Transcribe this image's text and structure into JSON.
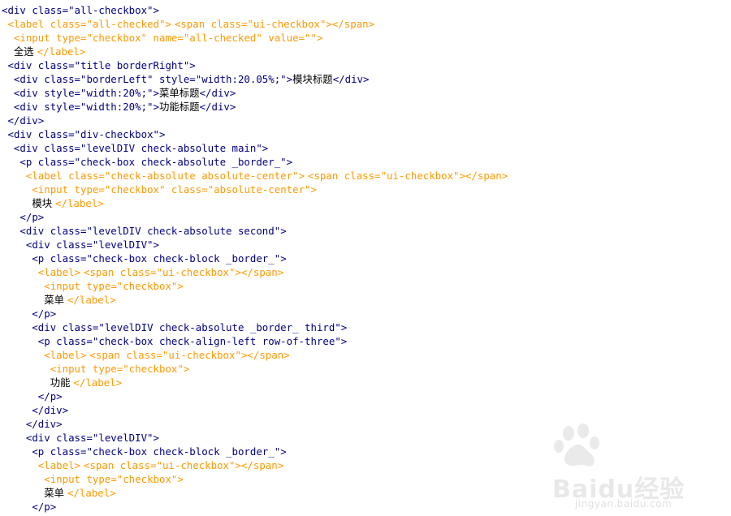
{
  "code_lines": [
    {
      "indent": 0,
      "kind": "",
      "tokens": [
        [
          "p",
          "<"
        ],
        [
          "t",
          "div"
        ],
        [
          "a",
          " class="
        ],
        [
          "s",
          "\"all-checkbox\""
        ],
        [
          "p",
          ">"
        ]
      ]
    },
    {
      "indent": 1,
      "kind": "lbl",
      "tokens": [
        [
          "p",
          "<"
        ],
        [
          "t",
          "label"
        ],
        [
          "a",
          " class="
        ],
        [
          "s",
          "\"all-checked\""
        ],
        [
          "p",
          ">"
        ],
        [
          "x",
          " "
        ],
        [
          "p",
          "<"
        ],
        [
          "t",
          "span"
        ],
        [
          "a",
          " class="
        ],
        [
          "s",
          "\"ui-checkbox\""
        ],
        [
          "p",
          "></"
        ],
        [
          "t",
          "span"
        ],
        [
          "p",
          ">"
        ]
      ]
    },
    {
      "indent": 2,
      "kind": "lbl",
      "tokens": [
        [
          "p",
          "<"
        ],
        [
          "t",
          "input"
        ],
        [
          "a",
          " type="
        ],
        [
          "s",
          "\"checkbox\""
        ],
        [
          "a",
          " name="
        ],
        [
          "s",
          "\"all-checked\""
        ],
        [
          "a",
          " value="
        ],
        [
          "s",
          "\"\""
        ],
        [
          "p",
          ">"
        ]
      ]
    },
    {
      "indent": 2,
      "kind": "lbl",
      "tokens": [
        [
          "x",
          "全选 "
        ],
        [
          "p",
          "</"
        ],
        [
          "t",
          "label"
        ],
        [
          "p",
          ">"
        ]
      ]
    },
    {
      "indent": 1,
      "kind": "",
      "tokens": [
        [
          "p",
          "<"
        ],
        [
          "t",
          "div"
        ],
        [
          "a",
          " class="
        ],
        [
          "s",
          "\"title borderRight\""
        ],
        [
          "p",
          ">"
        ]
      ]
    },
    {
      "indent": 2,
      "kind": "",
      "tokens": [
        [
          "p",
          "<"
        ],
        [
          "t",
          "div"
        ],
        [
          "a",
          " class="
        ],
        [
          "s",
          "\"borderLeft\""
        ],
        [
          "a",
          " style="
        ],
        [
          "s",
          "\"width:20.05%;\""
        ],
        [
          "p",
          ">"
        ],
        [
          "x",
          "模块标题"
        ],
        [
          "p",
          "</"
        ],
        [
          "t",
          "div"
        ],
        [
          "p",
          ">"
        ]
      ]
    },
    {
      "indent": 2,
      "kind": "",
      "tokens": [
        [
          "p",
          "<"
        ],
        [
          "t",
          "div"
        ],
        [
          "a",
          " style="
        ],
        [
          "s",
          "\"width:20%;\""
        ],
        [
          "p",
          ">"
        ],
        [
          "x",
          "菜单标题"
        ],
        [
          "p",
          "</"
        ],
        [
          "t",
          "div"
        ],
        [
          "p",
          ">"
        ]
      ]
    },
    {
      "indent": 2,
      "kind": "",
      "tokens": [
        [
          "p",
          "<"
        ],
        [
          "t",
          "div"
        ],
        [
          "a",
          " style="
        ],
        [
          "s",
          "\"width:20%;\""
        ],
        [
          "p",
          ">"
        ],
        [
          "x",
          "功能标题"
        ],
        [
          "p",
          "</"
        ],
        [
          "t",
          "div"
        ],
        [
          "p",
          ">"
        ]
      ]
    },
    {
      "indent": 1,
      "kind": "",
      "tokens": [
        [
          "p",
          "</"
        ],
        [
          "t",
          "div"
        ],
        [
          "p",
          ">"
        ]
      ]
    },
    {
      "indent": 1,
      "kind": "",
      "tokens": [
        [
          "p",
          "<"
        ],
        [
          "t",
          "div"
        ],
        [
          "a",
          " class="
        ],
        [
          "s",
          "\"div-checkbox\""
        ],
        [
          "p",
          ">"
        ]
      ]
    },
    {
      "indent": 2,
      "kind": "",
      "tokens": [
        [
          "p",
          "<"
        ],
        [
          "t",
          "div"
        ],
        [
          "a",
          " class="
        ],
        [
          "s",
          "\"levelDIV check-absolute main\""
        ],
        [
          "p",
          ">"
        ]
      ]
    },
    {
      "indent": 3,
      "kind": "",
      "tokens": [
        [
          "p",
          "<"
        ],
        [
          "t",
          "p"
        ],
        [
          "a",
          " class="
        ],
        [
          "s",
          "\"check-box check-absolute _border_\""
        ],
        [
          "p",
          ">"
        ]
      ]
    },
    {
      "indent": 4,
      "kind": "lbl",
      "tokens": [
        [
          "p",
          "<"
        ],
        [
          "t",
          "label"
        ],
        [
          "a",
          " class="
        ],
        [
          "s",
          "\"check-absolute absolute-center\""
        ],
        [
          "p",
          ">"
        ],
        [
          "x",
          " "
        ],
        [
          "p",
          "<"
        ],
        [
          "t",
          "span"
        ],
        [
          "a",
          " class="
        ],
        [
          "s",
          "\"ui-checkbox\""
        ],
        [
          "p",
          "></"
        ],
        [
          "t",
          "span"
        ],
        [
          "p",
          ">"
        ]
      ]
    },
    {
      "indent": 5,
      "kind": "lbl",
      "tokens": [
        [
          "p",
          "<"
        ],
        [
          "t",
          "input"
        ],
        [
          "a",
          " type="
        ],
        [
          "s",
          "\"checkbox\""
        ],
        [
          "a",
          " class="
        ],
        [
          "s",
          "\"absolute-center\""
        ],
        [
          "p",
          ">"
        ]
      ]
    },
    {
      "indent": 5,
      "kind": "lbl",
      "tokens": [
        [
          "x",
          "模块 "
        ],
        [
          "p",
          "</"
        ],
        [
          "t",
          "label"
        ],
        [
          "p",
          ">"
        ]
      ]
    },
    {
      "indent": 3,
      "kind": "",
      "tokens": [
        [
          "p",
          "</"
        ],
        [
          "t",
          "p"
        ],
        [
          "p",
          ">"
        ]
      ]
    },
    {
      "indent": 3,
      "kind": "",
      "tokens": [
        [
          "p",
          "<"
        ],
        [
          "t",
          "div"
        ],
        [
          "a",
          " class="
        ],
        [
          "s",
          "\"levelDIV check-absolute second\""
        ],
        [
          "p",
          ">"
        ]
      ]
    },
    {
      "indent": 4,
      "kind": "",
      "tokens": [
        [
          "p",
          "<"
        ],
        [
          "t",
          "div"
        ],
        [
          "a",
          " class="
        ],
        [
          "s",
          "\"levelDIV\""
        ],
        [
          "p",
          ">"
        ]
      ]
    },
    {
      "indent": 5,
      "kind": "",
      "tokens": [
        [
          "p",
          "<"
        ],
        [
          "t",
          "p"
        ],
        [
          "a",
          " class="
        ],
        [
          "s",
          "\"check-box check-block _border_\""
        ],
        [
          "p",
          ">"
        ]
      ]
    },
    {
      "indent": 6,
      "kind": "lbl",
      "tokens": [
        [
          "p",
          "<"
        ],
        [
          "t",
          "label"
        ],
        [
          "p",
          ">"
        ],
        [
          "x",
          " "
        ],
        [
          "p",
          "<"
        ],
        [
          "t",
          "span"
        ],
        [
          "a",
          " class="
        ],
        [
          "s",
          "\"ui-checkbox\""
        ],
        [
          "p",
          "></"
        ],
        [
          "t",
          "span"
        ],
        [
          "p",
          ">"
        ]
      ]
    },
    {
      "indent": 7,
      "kind": "lbl",
      "tokens": [
        [
          "p",
          "<"
        ],
        [
          "t",
          "input"
        ],
        [
          "a",
          " type="
        ],
        [
          "s",
          "\"checkbox\""
        ],
        [
          "p",
          ">"
        ]
      ]
    },
    {
      "indent": 7,
      "kind": "lbl",
      "tokens": [
        [
          "x",
          "菜单 "
        ],
        [
          "p",
          "</"
        ],
        [
          "t",
          "label"
        ],
        [
          "p",
          ">"
        ]
      ]
    },
    {
      "indent": 5,
      "kind": "",
      "tokens": [
        [
          "p",
          "</"
        ],
        [
          "t",
          "p"
        ],
        [
          "p",
          ">"
        ]
      ]
    },
    {
      "indent": 5,
      "kind": "",
      "tokens": [
        [
          "p",
          "<"
        ],
        [
          "t",
          "div"
        ],
        [
          "a",
          " class="
        ],
        [
          "s",
          "\"levelDIV check-absolute _border_ third\""
        ],
        [
          "p",
          ">"
        ]
      ]
    },
    {
      "indent": 6,
      "kind": "",
      "tokens": [
        [
          "p",
          "<"
        ],
        [
          "t",
          "p"
        ],
        [
          "a",
          " class="
        ],
        [
          "s",
          "\"check-box check-align-left row-of-three\""
        ],
        [
          "p",
          ">"
        ]
      ]
    },
    {
      "indent": 7,
      "kind": "lbl",
      "tokens": [
        [
          "p",
          "<"
        ],
        [
          "t",
          "label"
        ],
        [
          "p",
          ">"
        ],
        [
          "x",
          " "
        ],
        [
          "p",
          "<"
        ],
        [
          "t",
          "span"
        ],
        [
          "a",
          " class="
        ],
        [
          "s",
          "\"ui-checkbox\""
        ],
        [
          "p",
          "></"
        ],
        [
          "t",
          "span"
        ],
        [
          "p",
          ">"
        ]
      ]
    },
    {
      "indent": 8,
      "kind": "lbl",
      "tokens": [
        [
          "p",
          "<"
        ],
        [
          "t",
          "input"
        ],
        [
          "a",
          " type="
        ],
        [
          "s",
          "\"checkbox\""
        ],
        [
          "p",
          ">"
        ]
      ]
    },
    {
      "indent": 8,
      "kind": "lbl",
      "tokens": [
        [
          "x",
          "功能 "
        ],
        [
          "p",
          "</"
        ],
        [
          "t",
          "label"
        ],
        [
          "p",
          ">"
        ]
      ]
    },
    {
      "indent": 6,
      "kind": "",
      "tokens": [
        [
          "p",
          "</"
        ],
        [
          "t",
          "p"
        ],
        [
          "p",
          ">"
        ]
      ]
    },
    {
      "indent": 5,
      "kind": "",
      "tokens": [
        [
          "p",
          "</"
        ],
        [
          "t",
          "div"
        ],
        [
          "p",
          ">"
        ]
      ]
    },
    {
      "indent": 4,
      "kind": "",
      "tokens": [
        [
          "p",
          "</"
        ],
        [
          "t",
          "div"
        ],
        [
          "p",
          ">"
        ]
      ]
    },
    {
      "indent": 4,
      "kind": "",
      "tokens": [
        [
          "p",
          "<"
        ],
        [
          "t",
          "div"
        ],
        [
          "a",
          " class="
        ],
        [
          "s",
          "\"levelDIV\""
        ],
        [
          "p",
          ">"
        ]
      ]
    },
    {
      "indent": 5,
      "kind": "",
      "tokens": [
        [
          "p",
          "<"
        ],
        [
          "t",
          "p"
        ],
        [
          "a",
          " class="
        ],
        [
          "s",
          "\"check-box check-block _border_\""
        ],
        [
          "p",
          ">"
        ]
      ]
    },
    {
      "indent": 6,
      "kind": "lbl",
      "tokens": [
        [
          "p",
          "<"
        ],
        [
          "t",
          "label"
        ],
        [
          "p",
          ">"
        ],
        [
          "x",
          " "
        ],
        [
          "p",
          "<"
        ],
        [
          "t",
          "span"
        ],
        [
          "a",
          " class="
        ],
        [
          "s",
          "\"ui-checkbox\""
        ],
        [
          "p",
          "></"
        ],
        [
          "t",
          "span"
        ],
        [
          "p",
          ">"
        ]
      ]
    },
    {
      "indent": 7,
      "kind": "lbl",
      "tokens": [
        [
          "p",
          "<"
        ],
        [
          "t",
          "input"
        ],
        [
          "a",
          " type="
        ],
        [
          "s",
          "\"checkbox\""
        ],
        [
          "p",
          ">"
        ]
      ]
    },
    {
      "indent": 7,
      "kind": "lbl",
      "tokens": [
        [
          "x",
          "菜单 "
        ],
        [
          "p",
          "</"
        ],
        [
          "t",
          "label"
        ],
        [
          "p",
          ">"
        ]
      ]
    },
    {
      "indent": 5,
      "kind": "",
      "tokens": [
        [
          "p",
          "</"
        ],
        [
          "t",
          "p"
        ],
        [
          "p",
          ">"
        ]
      ]
    }
  ],
  "colors": {
    "tag": "#000080",
    "label_block": "#ff9900",
    "text": "#000000",
    "background": "#ffffff",
    "watermark": "#d6d6d6"
  },
  "watermark": {
    "logo_icon": "baidu-paw-icon",
    "brand": "Baidu经验",
    "url": "jingyan.baidu.com"
  }
}
